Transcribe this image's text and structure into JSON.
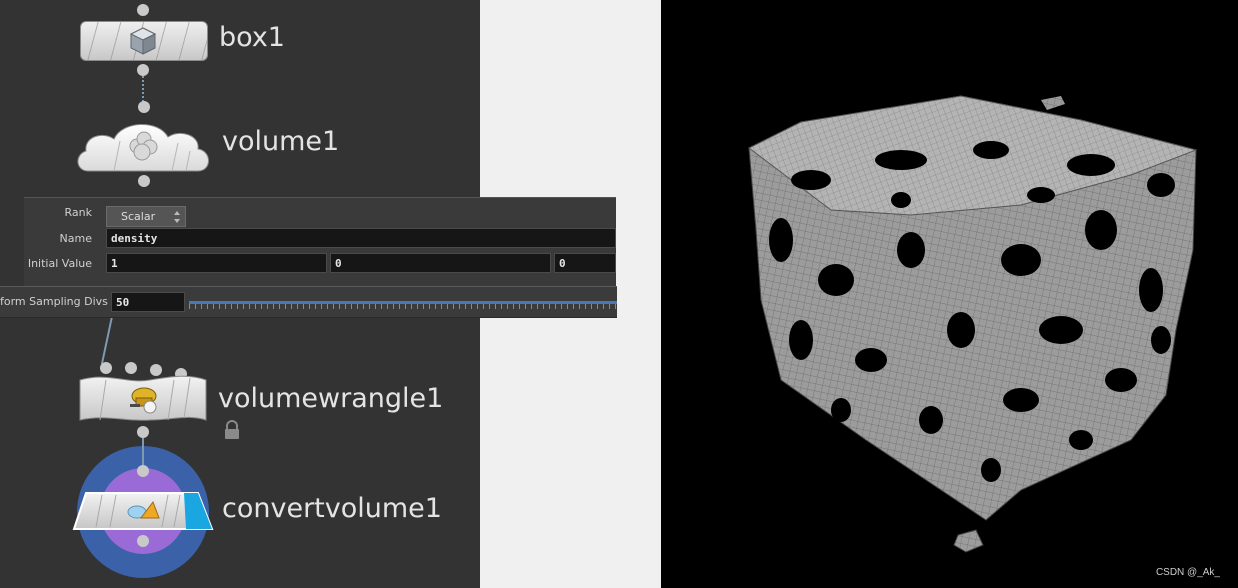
{
  "nodes": {
    "box": {
      "label": "box1",
      "icon": "cube-icon"
    },
    "volume": {
      "label": "volume1",
      "icon": "cloud-icon"
    },
    "volumewrangle": {
      "label": "volumewrangle1",
      "icon": "wrangler-icon",
      "locked": true
    },
    "convertvolume": {
      "label": "convertvolume1",
      "icon": "convert-icon"
    }
  },
  "parameters": {
    "rank": {
      "label": "Rank",
      "value": "Scalar"
    },
    "name": {
      "label": "Name",
      "value": "density"
    },
    "initial_value": {
      "label": "Initial Value",
      "values": [
        "1",
        "0",
        "0"
      ]
    },
    "sampling": {
      "label": "form Sampling Divs",
      "value": "50"
    }
  },
  "viewport": {
    "watermark": "CSDN @_Ak_"
  },
  "colors": {
    "network_bg": "#333333",
    "viewport_bg": "#000000",
    "wire": "#7f9bb3",
    "accent_blue": "#1aa6e0",
    "display_flag_outer": "#3b62a8",
    "display_flag_inner": "#9a6bd6"
  }
}
